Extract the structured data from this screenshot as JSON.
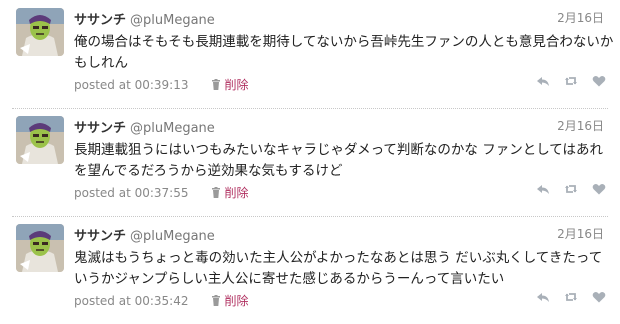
{
  "tweets": [
    {
      "display_name": "ササンチ",
      "handle": "@pluMegane",
      "date": "2月16日",
      "text": "俺の場合はそもそも長期連載を期待してないから吾峠先生ファンの人とも意見合わないかもしれん",
      "posted": "posted at 00:39:13",
      "delete_label": "削除"
    },
    {
      "display_name": "ササンチ",
      "handle": "@pluMegane",
      "date": "2月16日",
      "text": "長期連載狙うにはいつもみたいなキャラじゃダメって判断なのかな ファンとしてはあれを望んでるだろうから逆効果な気もするけど",
      "posted": "posted at 00:37:55",
      "delete_label": "削除"
    },
    {
      "display_name": "ササンチ",
      "handle": "@pluMegane",
      "date": "2月16日",
      "text": "鬼滅はもうちょっと毒の効いた主人公がよかったなあとは思う だいぶ丸くしてきたっていうかジャンプらしい主人公に寄せた感じあるからうーんって言いたい",
      "posted": "posted at 00:35:42",
      "delete_label": "削除"
    }
  ],
  "icons": {
    "reply": "reply-icon",
    "retweet": "retweet-icon",
    "favorite": "heart-icon",
    "delete": "trash-icon"
  },
  "colors": {
    "delete_link": "#b03060",
    "meta_text": "#888888",
    "action_icon": "#a9b0b8"
  }
}
